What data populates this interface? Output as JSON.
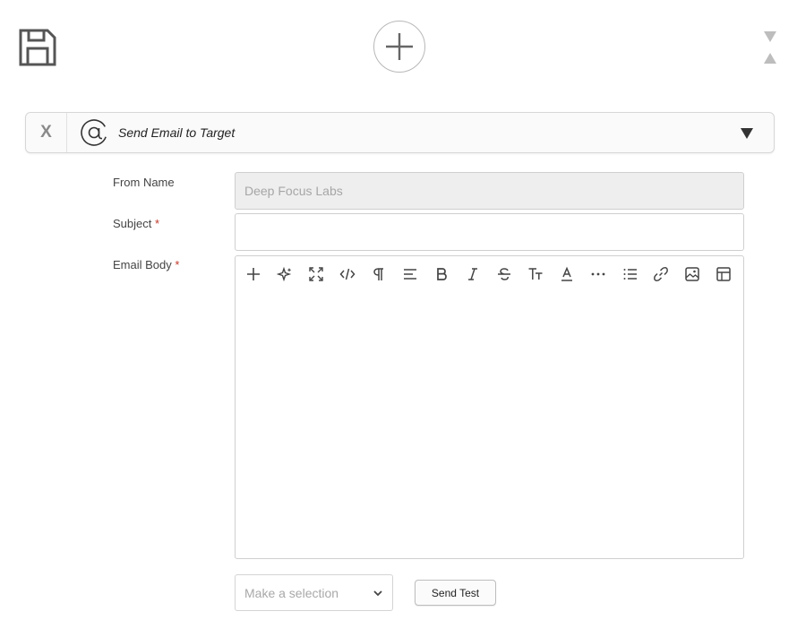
{
  "top_bar": {
    "save_icon": "floppy-disk-icon",
    "add_icon": "plus-circle-icon",
    "sort_down_icon": "triangle-down-icon",
    "sort_up_icon": "triangle-up-icon"
  },
  "action": {
    "close_label": "X",
    "title": "Send Email to Target",
    "icon": "at-sign-icon",
    "collapse_icon": "triangle-down-icon"
  },
  "form": {
    "from_name": {
      "label": "From Name",
      "value": "Deep Focus Labs"
    },
    "subject": {
      "label": "Subject",
      "required_mark": "*",
      "value": ""
    },
    "email_body": {
      "label": "Email Body",
      "required_mark": "*"
    }
  },
  "toolbar_icons": [
    "plus-icon",
    "sparkles-icon",
    "fullscreen-icon",
    "code-icon",
    "paragraph-icon",
    "align-icon",
    "bold-icon",
    "italic-icon",
    "strikethrough-icon",
    "font-size-icon",
    "text-color-icon",
    "more-icon",
    "list-icon",
    "link-icon",
    "image-icon",
    "table-icon"
  ],
  "footer": {
    "select_placeholder": "Make a selection",
    "send_test_label": "Send Test"
  },
  "colors": {
    "required": "#c0392b",
    "disabled_bg": "#eeeeee",
    "border": "#cfcfcf"
  }
}
